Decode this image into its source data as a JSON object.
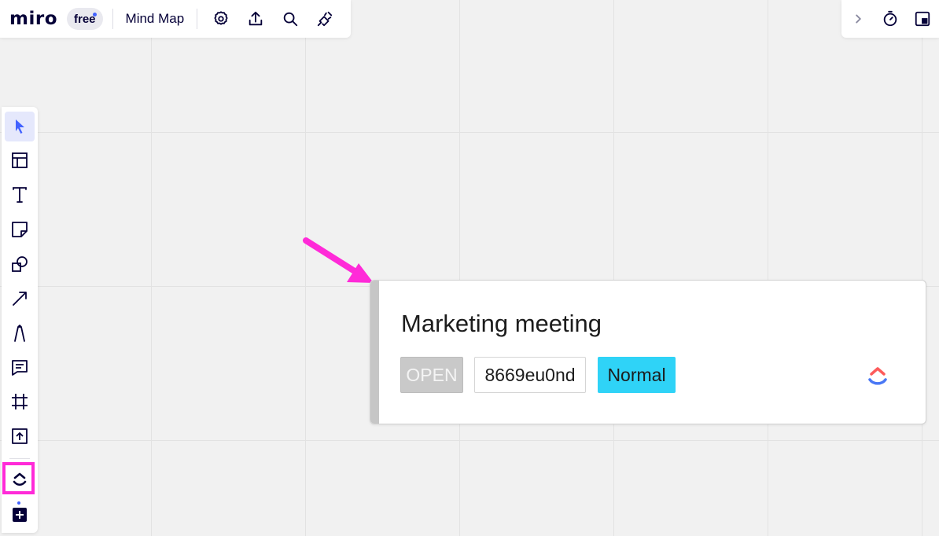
{
  "app": {
    "logo_text": "miro",
    "plan_badge": "free",
    "board_title": "Mind Map"
  },
  "topbar_icons": [
    "gear-icon",
    "upload-icon",
    "search-icon",
    "plug-icon"
  ],
  "topright_icons": [
    "chevron-right-icon",
    "timer-icon",
    "present-icon"
  ],
  "left_toolbar": {
    "tools": [
      "select",
      "templates",
      "text",
      "sticky-note",
      "shapes",
      "connection-line",
      "pen",
      "comment",
      "frame",
      "upload",
      "clickup-app",
      "add-more"
    ],
    "active_tool": "select",
    "highlighted_tool": "clickup-app"
  },
  "card": {
    "title": "Marketing meeting",
    "status": "OPEN",
    "task_id": "8669eu0nd",
    "priority": "Normal",
    "colors": {
      "stripe": "#c6c6c6",
      "status_bg": "#c9c9c9",
      "priority_bg": "#2fd3f7"
    }
  },
  "annotation": {
    "color": "#ff2ad8"
  }
}
